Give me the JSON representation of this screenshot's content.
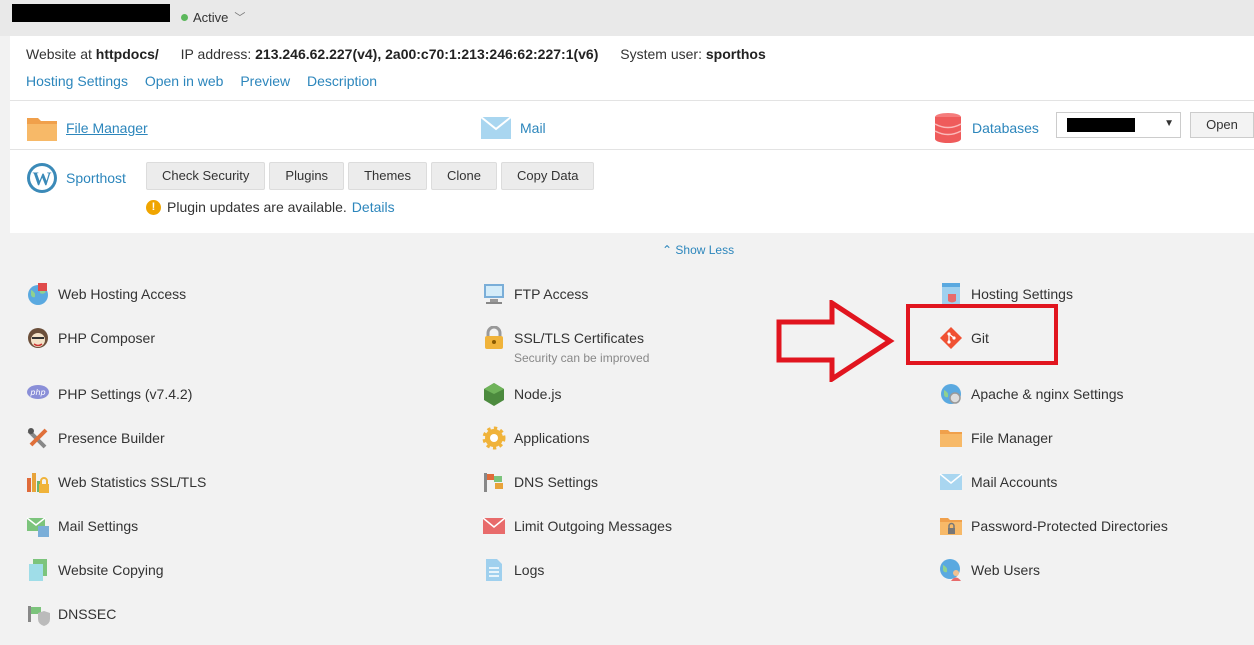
{
  "header": {
    "status_label": "Active"
  },
  "site": {
    "website_at_label": "Website at",
    "website_path": "httpdocs/",
    "ip_label": "IP address:",
    "ip_value": "213.246.62.227(v4), 2a00:c70:1:213:246:62:227:1(v6)",
    "user_label": "System user:",
    "user_value": "sporthos",
    "links": [
      "Hosting Settings",
      "Open in web",
      "Preview",
      "Description"
    ]
  },
  "quick_tools": {
    "file_manager": "File Manager",
    "mail": "Mail",
    "databases": "Databases",
    "open_button": "Open"
  },
  "wordpress": {
    "name": "Sporthost",
    "buttons": [
      "Check Security",
      "Plugins",
      "Themes",
      "Clone",
      "Copy Data"
    ],
    "notice": "Plugin updates are available.",
    "notice_link": "Details"
  },
  "show_less": "Show Less",
  "tools": {
    "col1": [
      {
        "label": "Web Hosting Access",
        "icon": "globe-icon"
      },
      {
        "label": "PHP Composer",
        "icon": "composer-icon"
      },
      {
        "label": "PHP Settings (v7.4.2)",
        "icon": "php-icon"
      },
      {
        "label": "Presence Builder",
        "icon": "builder-tools-icon"
      },
      {
        "label": "Web Statistics SSL/TLS",
        "icon": "stats-lock-icon"
      },
      {
        "label": "Mail Settings",
        "icon": "mail-settings-icon"
      },
      {
        "label": "Website Copying",
        "icon": "copy-icon"
      },
      {
        "label": "DNSSEC",
        "icon": "dnssec-icon"
      }
    ],
    "col2": [
      {
        "label": "FTP Access",
        "icon": "ftp-icon"
      },
      {
        "label": "SSL/TLS Certificates",
        "sub": "Security can be improved",
        "icon": "lock-icon"
      },
      {
        "label": "Node.js",
        "icon": "nodejs-icon"
      },
      {
        "label": "Applications",
        "icon": "gear-icon"
      },
      {
        "label": "DNS Settings",
        "icon": "dns-icon"
      },
      {
        "label": "Limit Outgoing Messages",
        "icon": "mail-limit-icon"
      },
      {
        "label": "Logs",
        "icon": "logs-icon"
      }
    ],
    "col3": [
      {
        "label": "Hosting Settings",
        "icon": "hosting-settings-icon"
      },
      {
        "label": "Git",
        "icon": "git-icon"
      },
      {
        "label": "Apache & nginx Settings",
        "icon": "apache-icon"
      },
      {
        "label": "File Manager",
        "icon": "folder-icon"
      },
      {
        "label": "Mail Accounts",
        "icon": "mail-icon"
      },
      {
        "label": "Password-Protected Directories",
        "icon": "protected-folder-icon"
      },
      {
        "label": "Web Users",
        "icon": "web-users-icon"
      }
    ]
  },
  "colors": {
    "link": "#2c86bc",
    "annotation_red": "#e1151f",
    "status_green": "#5cb85c"
  }
}
